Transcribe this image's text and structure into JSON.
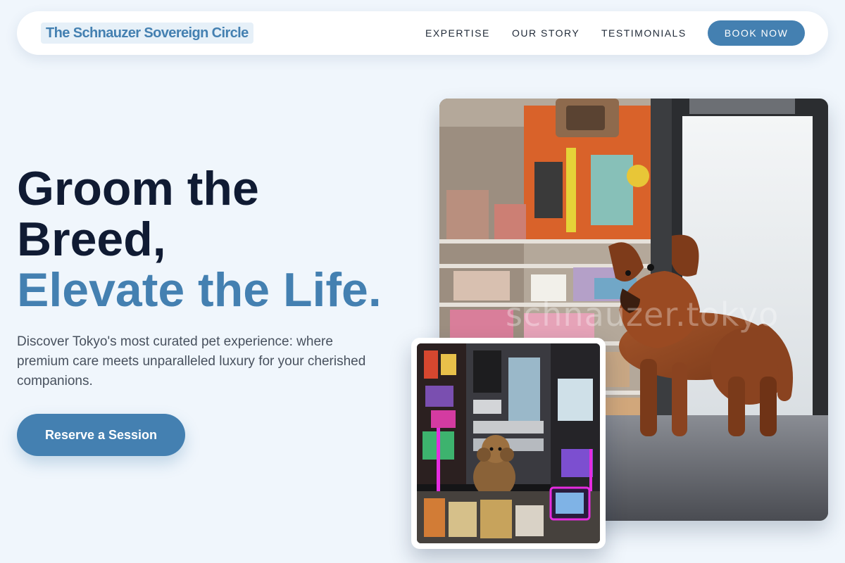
{
  "nav": {
    "brand": "The Schnauzer Sovereign Circle",
    "links": [
      "EXPERTISE",
      "OUR STORY",
      "TESTIMONIALS"
    ],
    "cta": "BOOK NOW"
  },
  "hero": {
    "headline_line1": "Groom the",
    "headline_line2": "Breed,",
    "headline_accent": "Elevate the Life.",
    "description": "Discover Tokyo's most curated pet experience: where premium care meets unparalleled luxury for your cherished companions.",
    "cta": "Reserve a Session"
  },
  "images": {
    "main_watermark": "schnauzer.tokyo"
  },
  "colors": {
    "accent": "#4480b1",
    "background": "#f0f6fc",
    "heading": "#101b33",
    "body_text": "#48515e"
  }
}
